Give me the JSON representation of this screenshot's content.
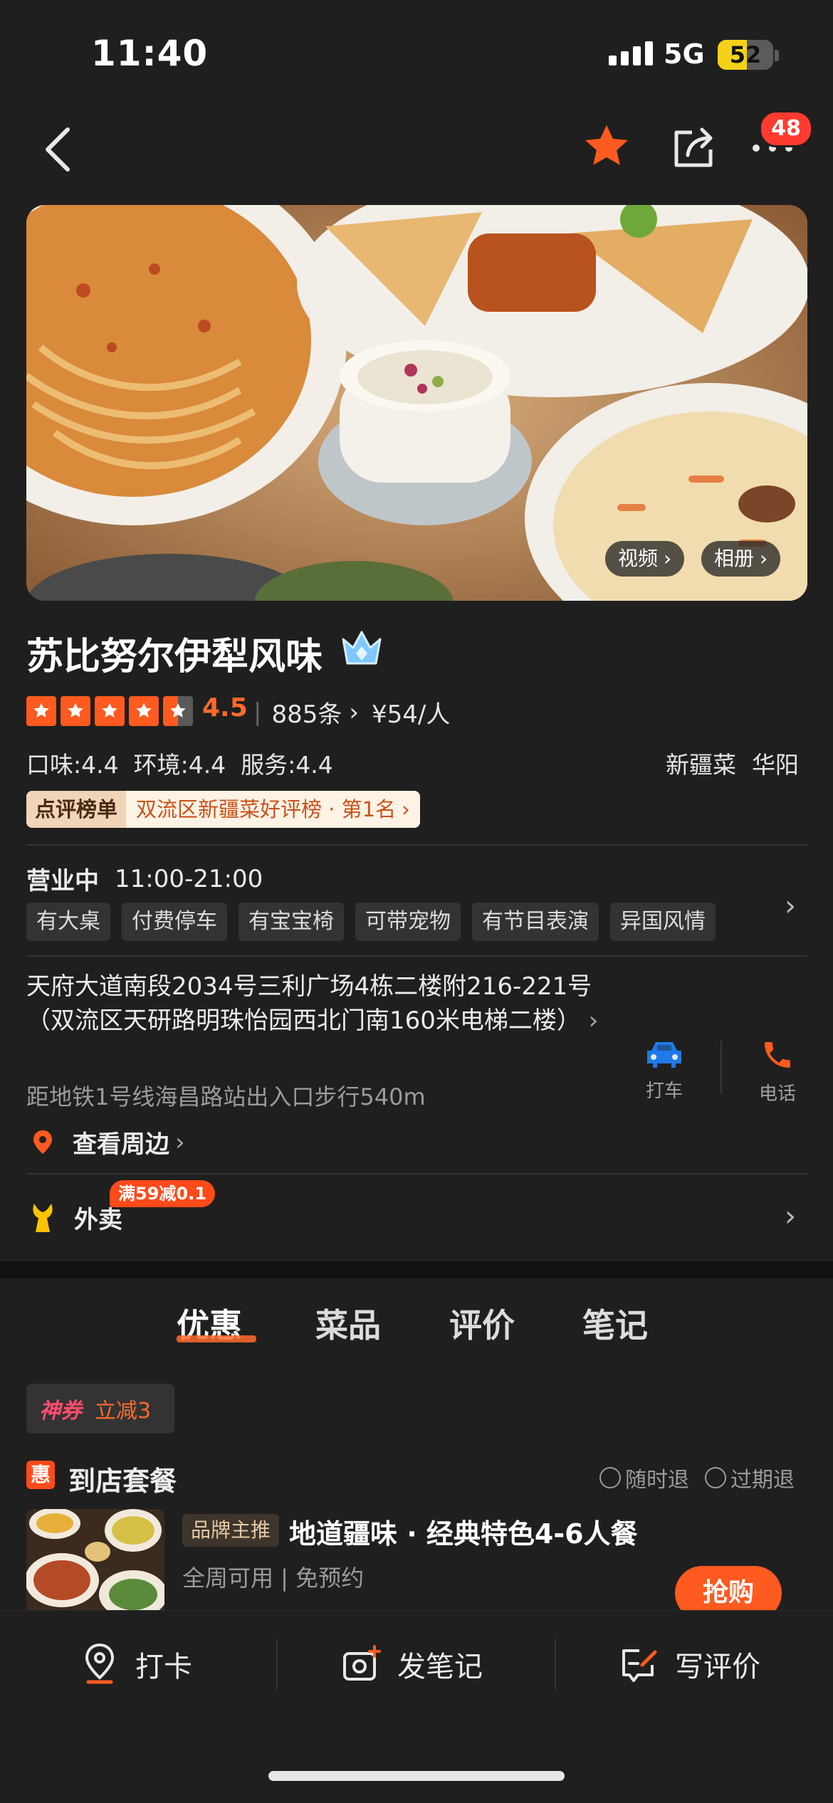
{
  "status_bar": {
    "time": "11:40",
    "network": "5G",
    "battery": "52",
    "battery_level": 0.52
  },
  "nav": {
    "back_icon": "chevron-left-icon",
    "favorite_icon": "star-icon",
    "share_icon": "share-icon",
    "more_icon": "more-dots-icon",
    "message_badge": "48"
  },
  "hero": {
    "video_label": "视频",
    "album_label": "相册"
  },
  "shop": {
    "name": "苏比努尔伊犁风味",
    "rating": 4.5,
    "rating_text": "4.5",
    "stars": 5,
    "review_count": "885条",
    "price": "¥54/人",
    "sub_scores": "口味:4.4  环境:4.4  服务:4.4",
    "category": "新疆菜",
    "area": "华阳",
    "rank_label": "点评榜单",
    "rank_text": "双流区新疆菜好评榜 · 第1名"
  },
  "info": {
    "status": "营业中",
    "hours": "11:00-21:00",
    "features": [
      "有大桌",
      "付费停车",
      "有宝宝椅",
      "可带宠物",
      "有节目表演",
      "异国风情"
    ],
    "address": "天府大道南段2034号三利广场4栋二楼附216-221号（双流区天研路明珠怡园西北门南160米电梯二楼）",
    "metro": "距地铁1号线海昌路站出入口步行540m",
    "taxi_label": "打车",
    "call_label": "电话",
    "nearby_label": "查看周边",
    "takeout_label": "外卖",
    "takeout_badge": "满59减0.1"
  },
  "tabs": [
    "优惠",
    "菜品",
    "评价",
    "笔记"
  ],
  "deals": {
    "voucher_a": "神券",
    "voucher_b": "立减3",
    "set_icon": "惠",
    "set_title": "到店套餐",
    "refund_any": "随时退",
    "refund_expired": "过期退",
    "brand_tag": "品牌主推",
    "package_name": "地道疆味 · 经典特色4-6人餐",
    "package_sub": "全周可用 | 免预约",
    "buy_label": "抢购"
  },
  "bottom_bar": {
    "checkin": "打卡",
    "post_note": "发笔记",
    "write_review": "写评价"
  },
  "colors": {
    "accent": "#ff5a1f",
    "background": "#1f1f1f",
    "badge": "#ff3b30"
  }
}
